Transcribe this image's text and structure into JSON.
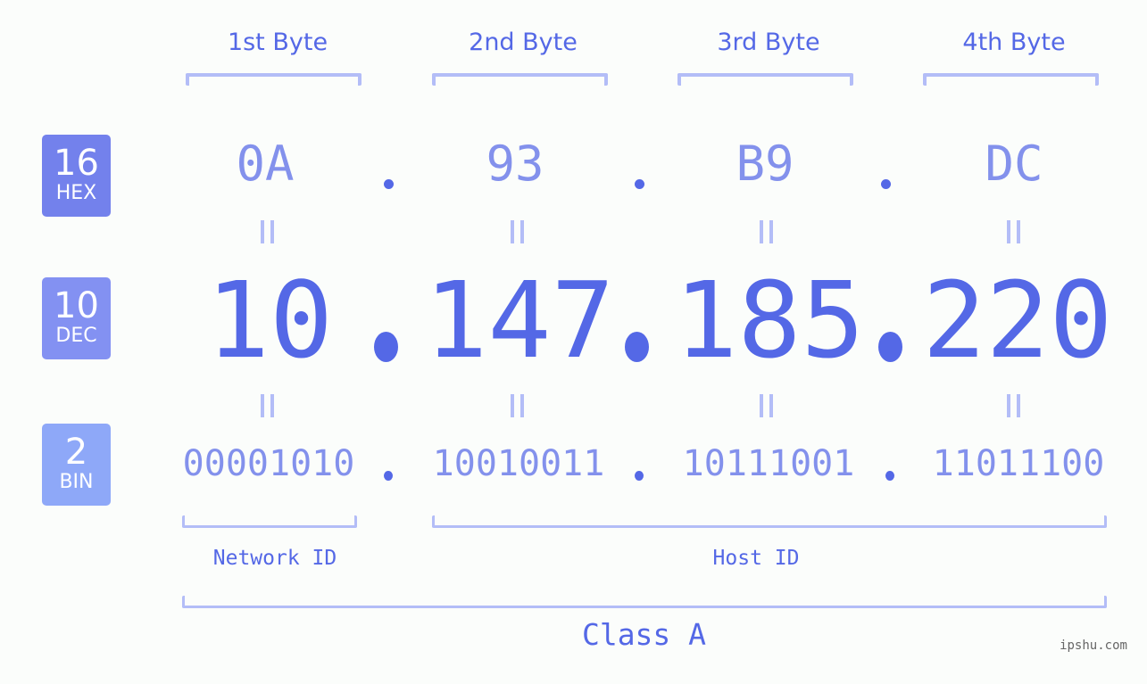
{
  "byte_headers": [
    "1st Byte",
    "2nd Byte",
    "3rd Byte",
    "4th Byte"
  ],
  "badges": {
    "hex": {
      "number": "16",
      "label": "HEX",
      "color": "#7381ec"
    },
    "dec": {
      "number": "10",
      "label": "DEC",
      "color": "#8391f2"
    },
    "bin": {
      "number": "2",
      "label": "BIN",
      "color": "#8ea8f8"
    }
  },
  "ip": {
    "hex": [
      "0A",
      "93",
      "B9",
      "DC"
    ],
    "dec": [
      "10",
      "147",
      "185",
      "220"
    ],
    "bin": [
      "00001010",
      "10010011",
      "10111001",
      "11011100"
    ]
  },
  "segments": {
    "network_id": "Network ID",
    "host_id": "Host ID",
    "ip_class": "Class A"
  },
  "watermark": "ipshu.com",
  "colors": {
    "accent": "#5468e6",
    "light_accent": "#8391ec",
    "bracket": "#b3bdf7",
    "background": "#fbfdfb"
  }
}
